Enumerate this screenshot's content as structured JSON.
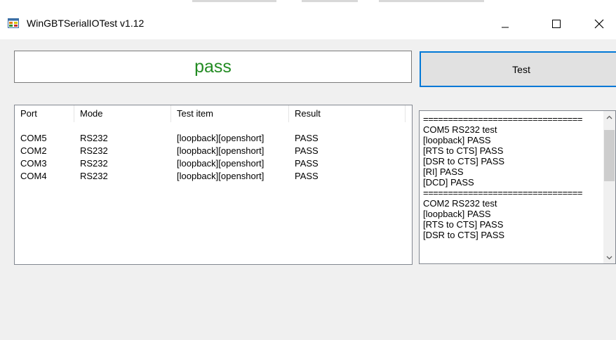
{
  "window": {
    "title": "WinGBTSerialIOTest v1.12"
  },
  "result_text": "pass",
  "test_button_label": "Test",
  "table": {
    "headers": [
      "Port",
      "Mode",
      "Test item",
      "Result"
    ],
    "rows": [
      [
        "COM5",
        "RS232",
        "[loopback][openshort]",
        "PASS"
      ],
      [
        "COM2",
        "RS232",
        "[loopback][openshort]",
        "PASS"
      ],
      [
        "COM3",
        "RS232",
        "[loopback][openshort]",
        "PASS"
      ],
      [
        "COM4",
        "RS232",
        "[loopback][openshort]",
        "PASS"
      ]
    ]
  },
  "log": {
    "lines": [
      "================================",
      "COM5 RS232 test",
      "[loopback] PASS",
      "[RTS to CTS] PASS",
      "[DSR to CTS] PASS",
      "[RI] PASS",
      "[DCD] PASS",
      "================================",
      "COM2 RS232 test",
      "[loopback] PASS",
      "[RTS to CTS] PASS",
      "[DSR to CTS] PASS"
    ]
  },
  "icons": {
    "app": "app-icon",
    "minimize": "minimize-icon",
    "maximize": "maximize-icon",
    "close": "close-icon",
    "scroll_up": "chevron-up-icon",
    "scroll_down": "chevron-down-icon"
  },
  "colors": {
    "pass_text": "#228b22",
    "focus_border": "#0078d7",
    "window_bg": "#f0f0f0"
  }
}
